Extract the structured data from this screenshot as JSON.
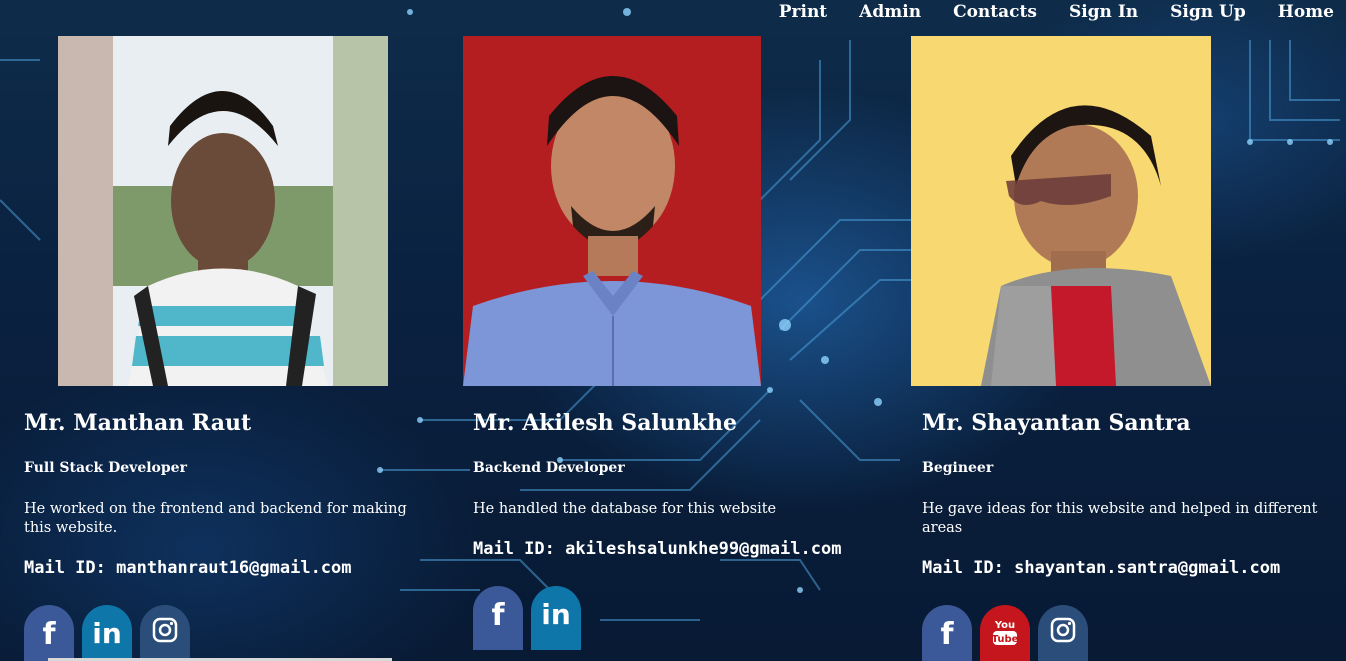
{
  "nav": {
    "items": [
      "Print",
      "Admin",
      "Contacts",
      "Sign In",
      "Sign Up",
      "Home"
    ]
  },
  "team": [
    {
      "name": "Mr. Manthan Raut",
      "role": "Full Stack Developer",
      "description": "He worked on the frontend and backend for making this website.",
      "mail": "Mail ID: manthanraut16@gmail.com",
      "socials": [
        "facebook-icon",
        "linkedin-icon",
        "instagram-icon"
      ]
    },
    {
      "name": "Mr. Akilesh Salunkhe",
      "role": "Backend Developer",
      "description": "He handled the database for this website",
      "mail": "Mail ID: akileshsalunkhe99@gmail.com",
      "socials": [
        "facebook-icon",
        "linkedin-icon"
      ]
    },
    {
      "name": "Mr. Shayantan Santra",
      "role": "Begineer",
      "description": "He gave ideas for this website and helped in different areas",
      "mail": "Mail ID: shayantan.santra@gmail.com",
      "socials": [
        "facebook-icon",
        "youtube-icon",
        "instagram-icon"
      ]
    }
  ],
  "colors": {
    "facebook": "#3b5998",
    "linkedin": "#0e76a8",
    "instagram": "#2a4d7a",
    "youtube": "#c4161c",
    "background": "#0a2140"
  }
}
